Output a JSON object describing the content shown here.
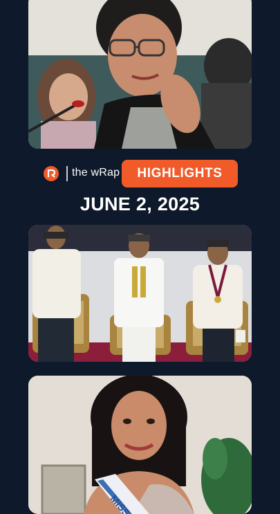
{
  "brand": {
    "logo_icon": "rappler-logo-icon",
    "show_name": "the wRap",
    "badge_label": "HIGHLIGHTS",
    "badge_color": "#f15a29"
  },
  "date": "JUNE 2, 2025",
  "cards": [
    {
      "id": "story-1",
      "image": "senator-speaking-at-hearing-photo"
    },
    {
      "id": "story-2",
      "image": "officials-at-ceremony-photo"
    },
    {
      "id": "story-3",
      "image": "beauty-queen-with-sash-photo",
      "sash_text": "MISS"
    }
  ],
  "colors": {
    "background": "#0e1a2b"
  }
}
